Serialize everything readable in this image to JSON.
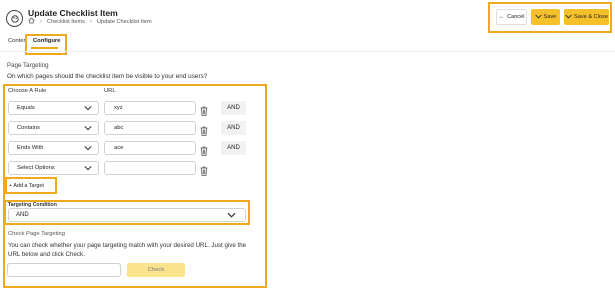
{
  "header": {
    "title": "Update Checklist Item",
    "breadcrumbs": [
      "Checklist Items",
      "Update Checklist Item"
    ],
    "icons": {
      "app": "palette-icon",
      "home": "home-icon",
      "separator": "chevron-right-icon"
    },
    "actions": {
      "cancel": "Cancel",
      "save": "Save",
      "save_close": "Save & Close"
    }
  },
  "tabs": [
    {
      "label": "Content",
      "display": "Conten",
      "active": false
    },
    {
      "label": "Configure",
      "active": true
    }
  ],
  "page_targeting": {
    "section_title": "Page Targeting",
    "question": "On which pages should the checklist item be visible to your end users?",
    "column_rule": "Choose A Rule",
    "column_url": "URL",
    "rules": [
      {
        "rule": "Equals",
        "url": "xyz",
        "operator": "AND"
      },
      {
        "rule": "Contains",
        "url": "abc",
        "operator": "AND"
      },
      {
        "rule": "Ends With",
        "url": "ace",
        "operator": "AND"
      },
      {
        "rule": "Select Options",
        "url": "",
        "operator": ""
      }
    ],
    "add_target": "+ Add a Target",
    "targeting_condition_label": "Targeting Condition",
    "targeting_condition_value": "AND"
  },
  "check": {
    "title": "Check Page Targeting",
    "description": "You can check whether your page targeting match with your desired URL. Just give the URL below and click Check.",
    "input_value": "",
    "button": "Check"
  },
  "colors": {
    "accent": "#f6c02b",
    "highlight": "#f0a91a",
    "check_button": "#fbe28c"
  }
}
